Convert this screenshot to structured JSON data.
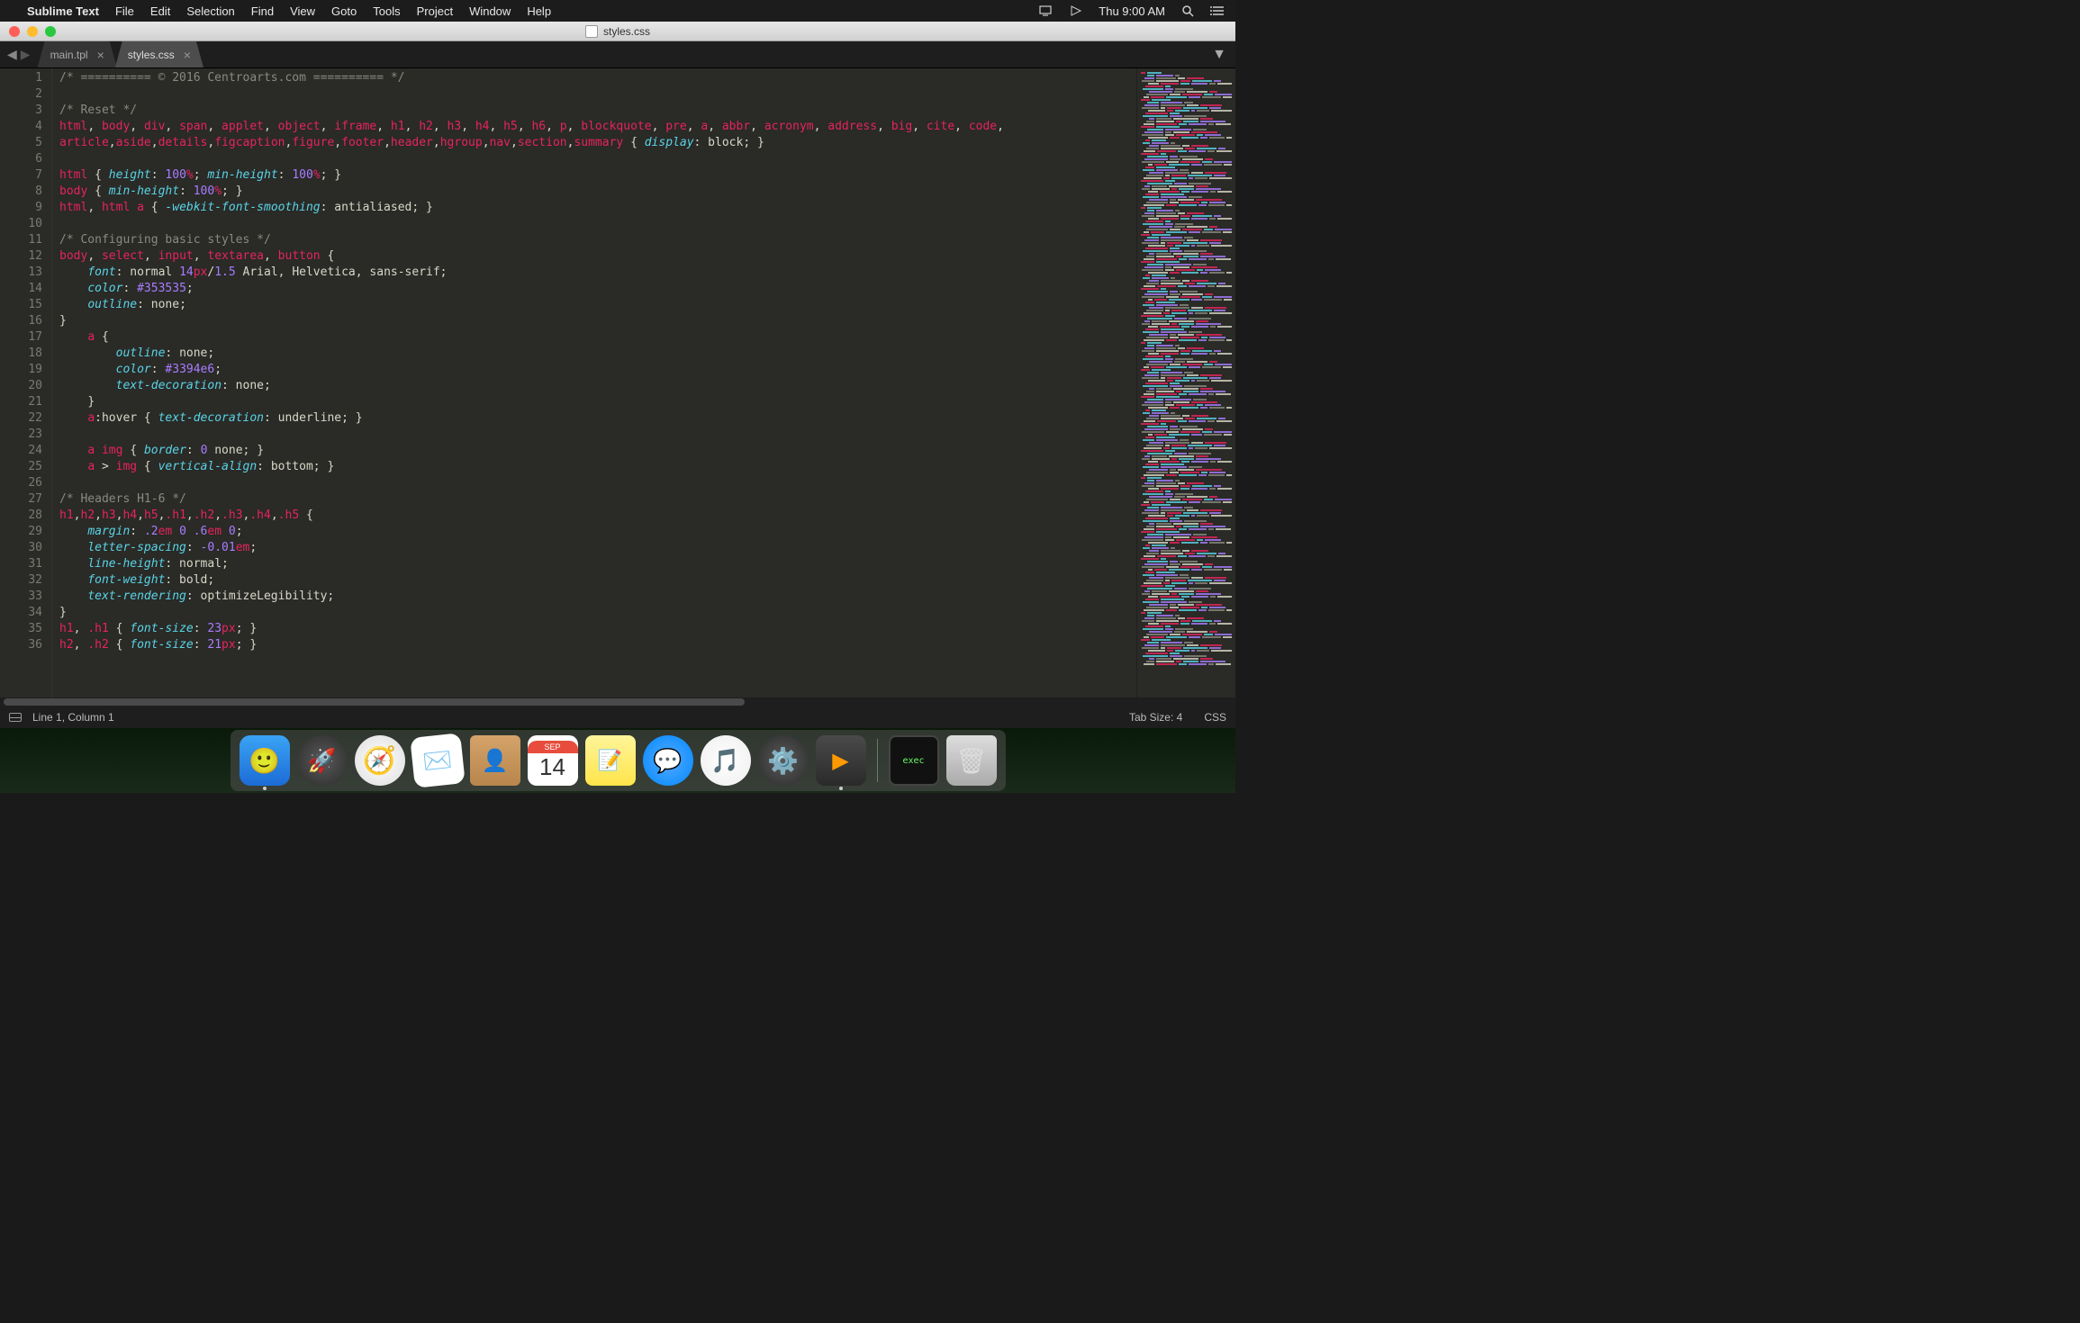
{
  "menubar": {
    "app_name": "Sublime Text",
    "items": [
      "File",
      "Edit",
      "Selection",
      "Find",
      "View",
      "Goto",
      "Tools",
      "Project",
      "Window",
      "Help"
    ],
    "clock": "Thu 9:00 AM"
  },
  "window": {
    "title": "styles.css"
  },
  "tabs": [
    {
      "name": "main.tpl",
      "active": false
    },
    {
      "name": "styles.css",
      "active": true
    }
  ],
  "statusbar": {
    "position": "Line 1, Column 1",
    "tab_size": "Tab Size: 4",
    "syntax": "CSS"
  },
  "calendar": {
    "month": "SEP",
    "day": "14"
  },
  "code_lines": [
    [
      {
        "t": "/* ========== © 2016 Centroarts.com ========== */",
        "c": "c-comment"
      }
    ],
    [],
    [
      {
        "t": "/* Reset */",
        "c": "c-comment"
      }
    ],
    [
      {
        "t": "html",
        "c": "c-tag"
      },
      {
        "t": ", ",
        "c": "c-punc"
      },
      {
        "t": "body",
        "c": "c-tag"
      },
      {
        "t": ", ",
        "c": "c-punc"
      },
      {
        "t": "div",
        "c": "c-tag"
      },
      {
        "t": ", ",
        "c": "c-punc"
      },
      {
        "t": "span",
        "c": "c-tag"
      },
      {
        "t": ", ",
        "c": "c-punc"
      },
      {
        "t": "applet",
        "c": "c-tag"
      },
      {
        "t": ", ",
        "c": "c-punc"
      },
      {
        "t": "object",
        "c": "c-tag"
      },
      {
        "t": ", ",
        "c": "c-punc"
      },
      {
        "t": "iframe",
        "c": "c-tag"
      },
      {
        "t": ", ",
        "c": "c-punc"
      },
      {
        "t": "h1",
        "c": "c-tag"
      },
      {
        "t": ", ",
        "c": "c-punc"
      },
      {
        "t": "h2",
        "c": "c-tag"
      },
      {
        "t": ", ",
        "c": "c-punc"
      },
      {
        "t": "h3",
        "c": "c-tag"
      },
      {
        "t": ", ",
        "c": "c-punc"
      },
      {
        "t": "h4",
        "c": "c-tag"
      },
      {
        "t": ", ",
        "c": "c-punc"
      },
      {
        "t": "h5",
        "c": "c-tag"
      },
      {
        "t": ", ",
        "c": "c-punc"
      },
      {
        "t": "h6",
        "c": "c-tag"
      },
      {
        "t": ", ",
        "c": "c-punc"
      },
      {
        "t": "p",
        "c": "c-tag"
      },
      {
        "t": ", ",
        "c": "c-punc"
      },
      {
        "t": "blockquote",
        "c": "c-tag"
      },
      {
        "t": ", ",
        "c": "c-punc"
      },
      {
        "t": "pre",
        "c": "c-tag"
      },
      {
        "t": ", ",
        "c": "c-punc"
      },
      {
        "t": "a",
        "c": "c-tag"
      },
      {
        "t": ", ",
        "c": "c-punc"
      },
      {
        "t": "abbr",
        "c": "c-tag"
      },
      {
        "t": ", ",
        "c": "c-punc"
      },
      {
        "t": "acronym",
        "c": "c-tag"
      },
      {
        "t": ", ",
        "c": "c-punc"
      },
      {
        "t": "address",
        "c": "c-tag"
      },
      {
        "t": ", ",
        "c": "c-punc"
      },
      {
        "t": "big",
        "c": "c-tag"
      },
      {
        "t": ", ",
        "c": "c-punc"
      },
      {
        "t": "cite",
        "c": "c-tag"
      },
      {
        "t": ", ",
        "c": "c-punc"
      },
      {
        "t": "code",
        "c": "c-tag"
      },
      {
        "t": ", ",
        "c": "c-punc"
      }
    ],
    [
      {
        "t": "article",
        "c": "c-tag"
      },
      {
        "t": ",",
        "c": "c-punc"
      },
      {
        "t": "aside",
        "c": "c-tag"
      },
      {
        "t": ",",
        "c": "c-punc"
      },
      {
        "t": "details",
        "c": "c-tag"
      },
      {
        "t": ",",
        "c": "c-punc"
      },
      {
        "t": "figcaption",
        "c": "c-tag"
      },
      {
        "t": ",",
        "c": "c-punc"
      },
      {
        "t": "figure",
        "c": "c-tag"
      },
      {
        "t": ",",
        "c": "c-punc"
      },
      {
        "t": "footer",
        "c": "c-tag"
      },
      {
        "t": ",",
        "c": "c-punc"
      },
      {
        "t": "header",
        "c": "c-tag"
      },
      {
        "t": ",",
        "c": "c-punc"
      },
      {
        "t": "hgroup",
        "c": "c-tag"
      },
      {
        "t": ",",
        "c": "c-punc"
      },
      {
        "t": "nav",
        "c": "c-tag"
      },
      {
        "t": ",",
        "c": "c-punc"
      },
      {
        "t": "section",
        "c": "c-tag"
      },
      {
        "t": ",",
        "c": "c-punc"
      },
      {
        "t": "summary",
        "c": "c-tag"
      },
      {
        "t": " { ",
        "c": "c-brace"
      },
      {
        "t": "display",
        "c": "c-prop"
      },
      {
        "t": ": block; ",
        "c": "c-val"
      },
      {
        "t": "}",
        "c": "c-brace"
      }
    ],
    [],
    [
      {
        "t": "html",
        "c": "c-tag"
      },
      {
        "t": " { ",
        "c": "c-brace"
      },
      {
        "t": "height",
        "c": "c-prop"
      },
      {
        "t": ": ",
        "c": "c-punc"
      },
      {
        "t": "100",
        "c": "c-num"
      },
      {
        "t": "%",
        "c": "c-unit"
      },
      {
        "t": "; ",
        "c": "c-punc"
      },
      {
        "t": "min-height",
        "c": "c-prop"
      },
      {
        "t": ": ",
        "c": "c-punc"
      },
      {
        "t": "100",
        "c": "c-num"
      },
      {
        "t": "%",
        "c": "c-unit"
      },
      {
        "t": "; ",
        "c": "c-punc"
      },
      {
        "t": "}",
        "c": "c-brace"
      }
    ],
    [
      {
        "t": "body",
        "c": "c-tag"
      },
      {
        "t": " { ",
        "c": "c-brace"
      },
      {
        "t": "min-height",
        "c": "c-prop"
      },
      {
        "t": ": ",
        "c": "c-punc"
      },
      {
        "t": "100",
        "c": "c-num"
      },
      {
        "t": "%",
        "c": "c-unit"
      },
      {
        "t": "; ",
        "c": "c-punc"
      },
      {
        "t": "}",
        "c": "c-brace"
      }
    ],
    [
      {
        "t": "html",
        "c": "c-tag"
      },
      {
        "t": ", ",
        "c": "c-punc"
      },
      {
        "t": "html",
        "c": "c-tag"
      },
      {
        "t": " ",
        "c": "c-punc"
      },
      {
        "t": "a",
        "c": "c-tag"
      },
      {
        "t": " { ",
        "c": "c-brace"
      },
      {
        "t": "-webkit-font-smoothing",
        "c": "c-prop"
      },
      {
        "t": ": antialiased; ",
        "c": "c-val"
      },
      {
        "t": "}",
        "c": "c-brace"
      }
    ],
    [],
    [
      {
        "t": "/* Configuring basic styles */",
        "c": "c-comment"
      }
    ],
    [
      {
        "t": "body",
        "c": "c-tag"
      },
      {
        "t": ", ",
        "c": "c-punc"
      },
      {
        "t": "select",
        "c": "c-tag"
      },
      {
        "t": ", ",
        "c": "c-punc"
      },
      {
        "t": "input",
        "c": "c-tag"
      },
      {
        "t": ", ",
        "c": "c-punc"
      },
      {
        "t": "textarea",
        "c": "c-tag"
      },
      {
        "t": ", ",
        "c": "c-punc"
      },
      {
        "t": "button",
        "c": "c-tag"
      },
      {
        "t": " {",
        "c": "c-brace"
      }
    ],
    [
      {
        "t": "    ",
        "c": ""
      },
      {
        "t": "font",
        "c": "c-prop"
      },
      {
        "t": ": normal ",
        "c": "c-val"
      },
      {
        "t": "14",
        "c": "c-num"
      },
      {
        "t": "px",
        "c": "c-unit"
      },
      {
        "t": "/",
        "c": "c-punc"
      },
      {
        "t": "1.5",
        "c": "c-num"
      },
      {
        "t": " Arial, Helvetica, sans-serif;",
        "c": "c-val"
      }
    ],
    [
      {
        "t": "    ",
        "c": ""
      },
      {
        "t": "color",
        "c": "c-prop"
      },
      {
        "t": ": ",
        "c": "c-punc"
      },
      {
        "t": "#353535",
        "c": "c-num"
      },
      {
        "t": ";",
        "c": "c-punc"
      }
    ],
    [
      {
        "t": "    ",
        "c": ""
      },
      {
        "t": "outline",
        "c": "c-prop"
      },
      {
        "t": ": none;",
        "c": "c-val"
      }
    ],
    [
      {
        "t": "}",
        "c": "c-brace"
      }
    ],
    [
      {
        "t": "    ",
        "c": ""
      },
      {
        "t": "a",
        "c": "c-tag"
      },
      {
        "t": " {",
        "c": "c-brace"
      }
    ],
    [
      {
        "t": "        ",
        "c": ""
      },
      {
        "t": "outline",
        "c": "c-prop"
      },
      {
        "t": ": none;",
        "c": "c-val"
      }
    ],
    [
      {
        "t": "        ",
        "c": ""
      },
      {
        "t": "color",
        "c": "c-prop"
      },
      {
        "t": ": ",
        "c": "c-punc"
      },
      {
        "t": "#3394e6",
        "c": "c-num"
      },
      {
        "t": ";",
        "c": "c-punc"
      }
    ],
    [
      {
        "t": "        ",
        "c": ""
      },
      {
        "t": "text-decoration",
        "c": "c-prop"
      },
      {
        "t": ": none;",
        "c": "c-val"
      }
    ],
    [
      {
        "t": "    ",
        "c": ""
      },
      {
        "t": "}",
        "c": "c-brace"
      }
    ],
    [
      {
        "t": "    ",
        "c": ""
      },
      {
        "t": "a",
        "c": "c-tag"
      },
      {
        "t": ":hover",
        "c": "c-val"
      },
      {
        "t": " { ",
        "c": "c-brace"
      },
      {
        "t": "text-decoration",
        "c": "c-prop"
      },
      {
        "t": ": underline; ",
        "c": "c-val"
      },
      {
        "t": "}",
        "c": "c-brace"
      }
    ],
    [],
    [
      {
        "t": "    ",
        "c": ""
      },
      {
        "t": "a",
        "c": "c-tag"
      },
      {
        "t": " ",
        "c": "c-punc"
      },
      {
        "t": "img",
        "c": "c-tag"
      },
      {
        "t": " { ",
        "c": "c-brace"
      },
      {
        "t": "border",
        "c": "c-prop"
      },
      {
        "t": ": ",
        "c": "c-punc"
      },
      {
        "t": "0",
        "c": "c-num"
      },
      {
        "t": " none; ",
        "c": "c-val"
      },
      {
        "t": "}",
        "c": "c-brace"
      }
    ],
    [
      {
        "t": "    ",
        "c": ""
      },
      {
        "t": "a",
        "c": "c-tag"
      },
      {
        "t": " > ",
        "c": "c-punc"
      },
      {
        "t": "img",
        "c": "c-tag"
      },
      {
        "t": " { ",
        "c": "c-brace"
      },
      {
        "t": "vertical-align",
        "c": "c-prop"
      },
      {
        "t": ": bottom; ",
        "c": "c-val"
      },
      {
        "t": "}",
        "c": "c-brace"
      }
    ],
    [],
    [
      {
        "t": "/* Headers H1-6 */",
        "c": "c-comment"
      }
    ],
    [
      {
        "t": "h1",
        "c": "c-tag"
      },
      {
        "t": ",",
        "c": "c-punc"
      },
      {
        "t": "h2",
        "c": "c-tag"
      },
      {
        "t": ",",
        "c": "c-punc"
      },
      {
        "t": "h3",
        "c": "c-tag"
      },
      {
        "t": ",",
        "c": "c-punc"
      },
      {
        "t": "h4",
        "c": "c-tag"
      },
      {
        "t": ",",
        "c": "c-punc"
      },
      {
        "t": "h5",
        "c": "c-tag"
      },
      {
        "t": ",",
        "c": "c-punc"
      },
      {
        "t": ".h1",
        "c": "c-tag"
      },
      {
        "t": ",",
        "c": "c-punc"
      },
      {
        "t": ".h2",
        "c": "c-tag"
      },
      {
        "t": ",",
        "c": "c-punc"
      },
      {
        "t": ".h3",
        "c": "c-tag"
      },
      {
        "t": ",",
        "c": "c-punc"
      },
      {
        "t": ".h4",
        "c": "c-tag"
      },
      {
        "t": ",",
        "c": "c-punc"
      },
      {
        "t": ".h5",
        "c": "c-tag"
      },
      {
        "t": " {",
        "c": "c-brace"
      }
    ],
    [
      {
        "t": "    ",
        "c": ""
      },
      {
        "t": "margin",
        "c": "c-prop"
      },
      {
        "t": ": ",
        "c": "c-punc"
      },
      {
        "t": ".2",
        "c": "c-num"
      },
      {
        "t": "em",
        "c": "c-unit"
      },
      {
        "t": " ",
        "c": "c-punc"
      },
      {
        "t": "0",
        "c": "c-num"
      },
      {
        "t": " ",
        "c": "c-punc"
      },
      {
        "t": ".6",
        "c": "c-num"
      },
      {
        "t": "em",
        "c": "c-unit"
      },
      {
        "t": " ",
        "c": "c-punc"
      },
      {
        "t": "0",
        "c": "c-num"
      },
      {
        "t": ";",
        "c": "c-punc"
      }
    ],
    [
      {
        "t": "    ",
        "c": ""
      },
      {
        "t": "letter-spacing",
        "c": "c-prop"
      },
      {
        "t": ": ",
        "c": "c-punc"
      },
      {
        "t": "-0.01",
        "c": "c-num"
      },
      {
        "t": "em",
        "c": "c-unit"
      },
      {
        "t": ";",
        "c": "c-punc"
      }
    ],
    [
      {
        "t": "    ",
        "c": ""
      },
      {
        "t": "line-height",
        "c": "c-prop"
      },
      {
        "t": ": normal;",
        "c": "c-val"
      }
    ],
    [
      {
        "t": "    ",
        "c": ""
      },
      {
        "t": "font-weight",
        "c": "c-prop"
      },
      {
        "t": ": bold;",
        "c": "c-val"
      }
    ],
    [
      {
        "t": "    ",
        "c": ""
      },
      {
        "t": "text-rendering",
        "c": "c-prop"
      },
      {
        "t": ": optimizeLegibility;",
        "c": "c-val"
      }
    ],
    [
      {
        "t": "}",
        "c": "c-brace"
      }
    ],
    [
      {
        "t": "h1",
        "c": "c-tag"
      },
      {
        "t": ", ",
        "c": "c-punc"
      },
      {
        "t": ".h1",
        "c": "c-tag"
      },
      {
        "t": " { ",
        "c": "c-brace"
      },
      {
        "t": "font-size",
        "c": "c-prop"
      },
      {
        "t": ": ",
        "c": "c-punc"
      },
      {
        "t": "23",
        "c": "c-num"
      },
      {
        "t": "px",
        "c": "c-unit"
      },
      {
        "t": "; ",
        "c": "c-punc"
      },
      {
        "t": "}",
        "c": "c-brace"
      }
    ],
    [
      {
        "t": "h2",
        "c": "c-tag"
      },
      {
        "t": ", ",
        "c": "c-punc"
      },
      {
        "t": ".h2",
        "c": "c-tag"
      },
      {
        "t": " { ",
        "c": "c-brace"
      },
      {
        "t": "font-size",
        "c": "c-prop"
      },
      {
        "t": ": ",
        "c": "c-punc"
      },
      {
        "t": "21",
        "c": "c-num"
      },
      {
        "t": "px",
        "c": "c-unit"
      },
      {
        "t": "; ",
        "c": "c-punc"
      },
      {
        "t": "}",
        "c": "c-brace"
      }
    ]
  ],
  "dock_apps": [
    "finder",
    "launchpad",
    "safari",
    "mail",
    "contacts",
    "calendar",
    "notes",
    "messages",
    "itunes",
    "settings",
    "sublime"
  ],
  "dock_right": [
    "terminal",
    "trash"
  ]
}
